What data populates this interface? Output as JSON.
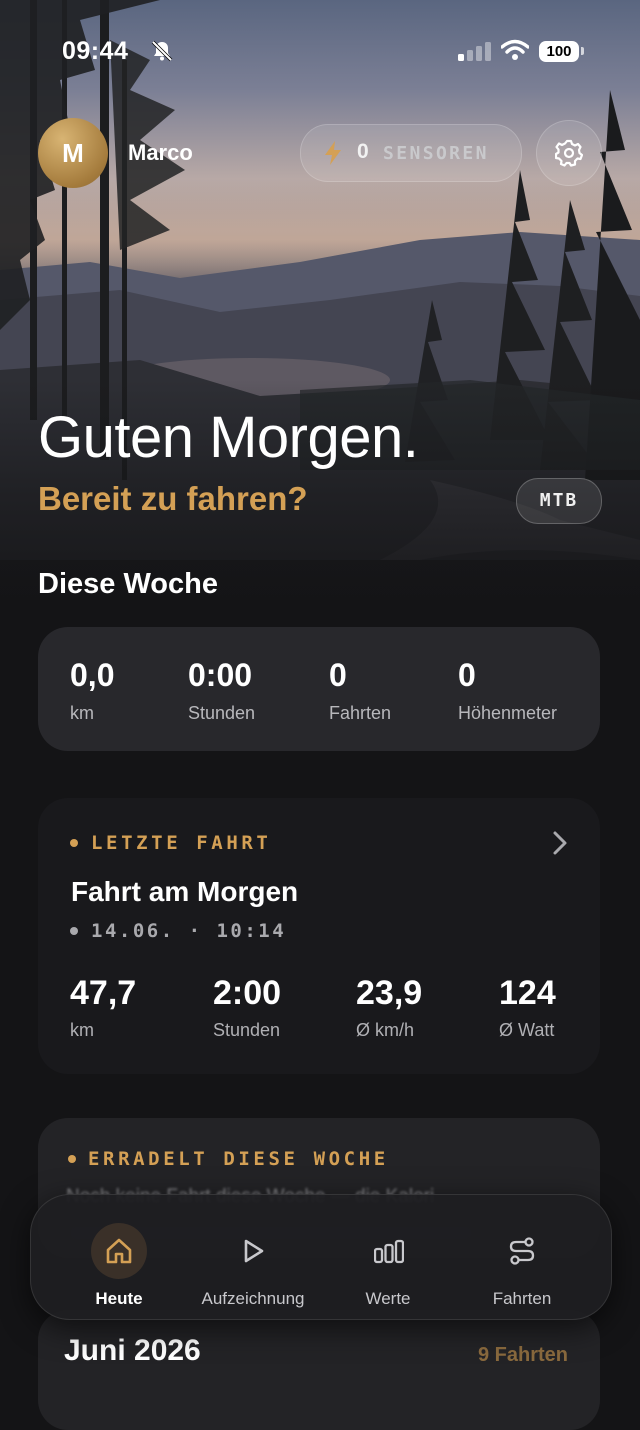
{
  "status_bar": {
    "time": "09:44",
    "battery": "100"
  },
  "header": {
    "avatar_initial": "M",
    "user_name": "Marco",
    "sensor_count": "0",
    "sensor_label": "SENSOREN"
  },
  "greeting": {
    "title": "Guten Morgen.",
    "subtitle": "Bereit zu fahren?",
    "bike_type": "MTB"
  },
  "week": {
    "title": "Diese Woche",
    "stats": [
      {
        "value": "0,0",
        "label": "km"
      },
      {
        "value": "0:00",
        "label": "Stunden"
      },
      {
        "value": "0",
        "label": "Fahrten"
      },
      {
        "value": "0",
        "label": "Höhenmeter"
      }
    ]
  },
  "last_ride": {
    "kicker": "LETZTE FAHRT",
    "title": "Fahrt am Morgen",
    "meta": "14.06. · 10:14",
    "stats": [
      {
        "value": "47,7",
        "label": "km"
      },
      {
        "value": "2:00",
        "label": "Stunden"
      },
      {
        "value": "23,9",
        "label": "Ø km/h"
      },
      {
        "value": "124",
        "label": "Ø Watt"
      }
    ]
  },
  "earned": {
    "kicker": "ERRADELT DIESE WOCHE",
    "text": "Noch keine Fahrt diese Woche — die Kalori"
  },
  "month": {
    "title": "Juni 2026",
    "count": "9 Fahrten"
  },
  "tabs": [
    {
      "label": "Heute",
      "icon": "home-icon",
      "active": true
    },
    {
      "label": "Aufzeichnung",
      "icon": "play-icon",
      "active": false
    },
    {
      "label": "Werte",
      "icon": "bars-icon",
      "active": false
    },
    {
      "label": "Fahrten",
      "icon": "route-icon",
      "active": false
    }
  ],
  "colors": {
    "accent": "#d4a055",
    "background": "#141416",
    "card": "#28282c"
  }
}
